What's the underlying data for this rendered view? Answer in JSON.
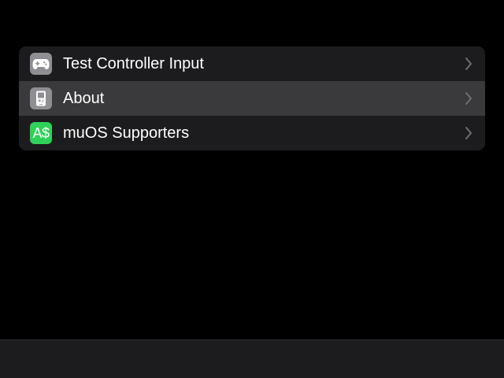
{
  "menu": {
    "items": [
      {
        "label": "Test Controller Input",
        "icon": "gamepad-icon",
        "icon_color": "#8e8e93",
        "selected": false
      },
      {
        "label": "About",
        "icon": "handheld-device-icon",
        "icon_color": "#8e8e93",
        "selected": true
      },
      {
        "label": "muOS Supporters",
        "icon": "currency-icon",
        "icon_text": "A$",
        "icon_color": "#30d158",
        "selected": false
      }
    ]
  },
  "colors": {
    "background": "#000000",
    "card": "#1c1c1e",
    "selected_row": "#3a3a3c",
    "text": "#ffffff",
    "chevron": "#6e6e73"
  }
}
